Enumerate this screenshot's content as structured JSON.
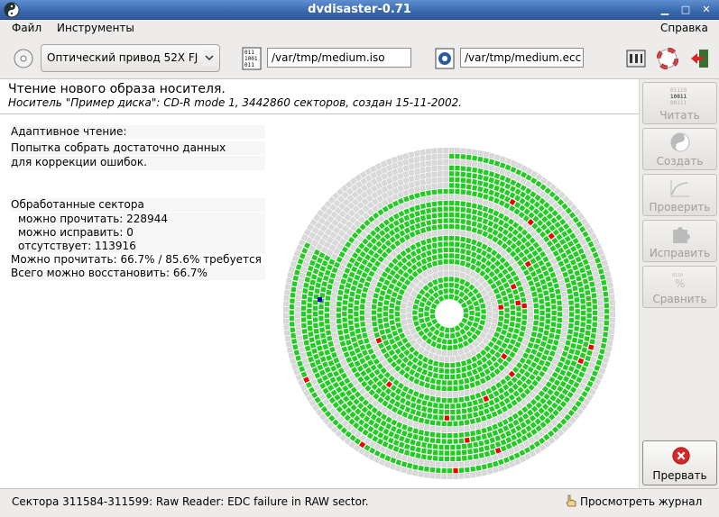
{
  "window": {
    "title": "dvdisaster-0.71"
  },
  "menubar": {
    "file": "Файл",
    "tools": "Инструменты",
    "help": "Справка"
  },
  "toolbar": {
    "drive": "Оптический привод 52X FJ",
    "image_path": "/var/tmp/medium.iso",
    "ecc_path": "/var/tmp/medium.ecc"
  },
  "main": {
    "heading": "Чтение нового образа носителя.",
    "medium_info": "Носитель \"Пример диска\": CD-R mode 1, 3442860 секторов, создан 15-11-2002.",
    "adaptive_label": "Адаптивное чтение:",
    "attempt_line1": "Попытка собрать достаточно данных",
    "attempt_line2": "для коррекции ошибок.",
    "processed_label": "Обработанные сектора",
    "readable": "можно прочитать: 228944",
    "correctable": "можно исправить: 0",
    "missing": "отсутствует: 113916",
    "readable_pct": "Можно прочитать: 66.7% / 85.6% требуется",
    "recoverable_pct": "Всего можно восстановить: 66.7%"
  },
  "sidebar": {
    "read": "Читать",
    "create": "Создать",
    "verify": "Проверить",
    "fix": "Исправить",
    "compare": "Сравнить",
    "abort": "Прервать"
  },
  "status": {
    "message": "Сектора 311584-311599: Raw Reader: EDC failure in RAW sector.",
    "log_button": "Просмотреть журнал"
  },
  "colors": {
    "readable": "#22cc22",
    "unread": "#d9d9d9",
    "error": "#ee0000",
    "current": "#0000cc"
  }
}
